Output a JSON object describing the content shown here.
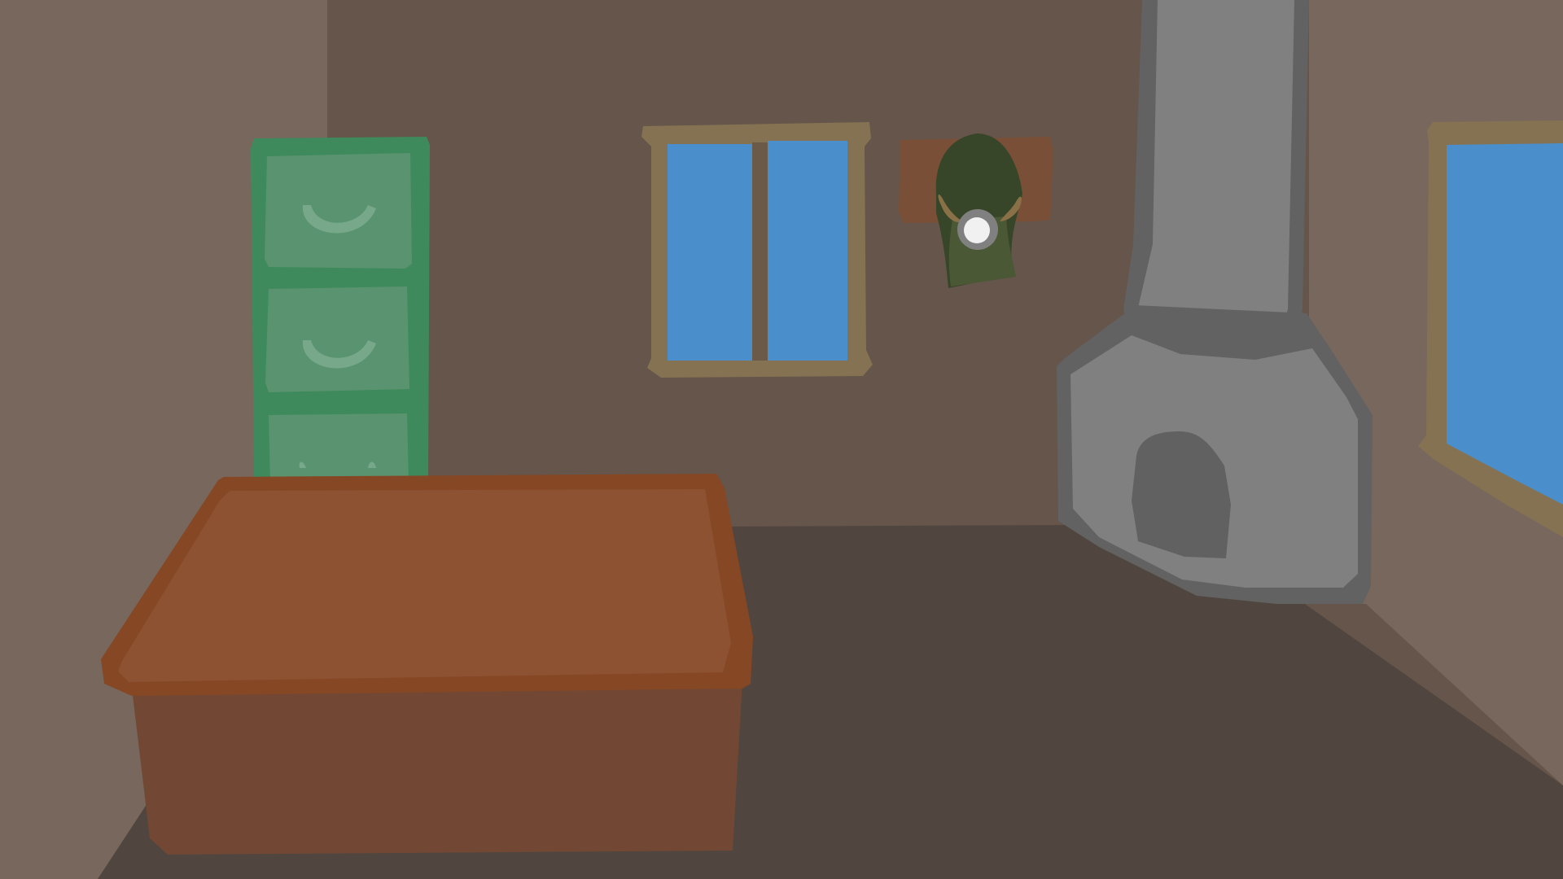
{
  "scene": {
    "room": "cabin-interior",
    "colors": {
      "back_wall": "#65554a",
      "side_wall": "#78675c",
      "floor": "#50463f",
      "window_frame": "#857252",
      "window_glass": "#4a8fcb",
      "cabinet_dark": "#3f8a5c",
      "cabinet_light": "#5a936f",
      "cabinet_handle": "#77a88a",
      "desk_top": "#8c5232",
      "desk_edge": "#864725",
      "desk_front": "#724834",
      "stove_grey": "#808080",
      "stove_outline": "#626262",
      "stove_opening": "#616161",
      "trophy_plaque": "#7a4f37",
      "trophy_dark": "#374628",
      "trophy_light": "#4a5835",
      "trophy_antler": "#8a7047",
      "trophy_lens": "#f1f1f1"
    },
    "objects": [
      {
        "id": "filing-cabinet",
        "icon": "filing-cabinet-icon",
        "drawers": 3
      },
      {
        "id": "desk",
        "icon": "desk-icon"
      },
      {
        "id": "back-window",
        "icon": "window-icon",
        "panes": 2
      },
      {
        "id": "wall-trophy",
        "icon": "mounted-head-icon"
      },
      {
        "id": "wood-stove",
        "icon": "stove-icon"
      },
      {
        "id": "side-window",
        "icon": "window-icon"
      }
    ]
  }
}
